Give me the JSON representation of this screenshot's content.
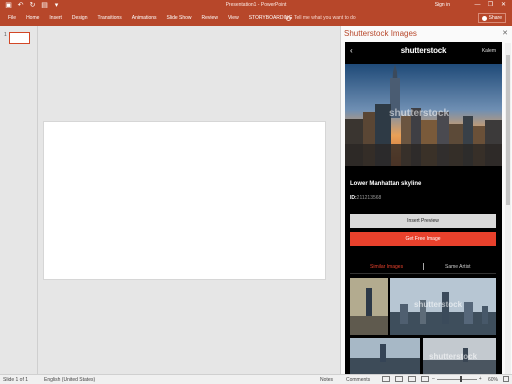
{
  "window": {
    "title": "Presentation1 - PowerPoint",
    "signin": "Sign in",
    "minimize_icon": "minimize-icon",
    "restore_icon": "restore-icon",
    "close_icon": "close-icon"
  },
  "qat": [
    "save-icon",
    "undo-icon",
    "redo-icon",
    "start-slideshow-icon",
    "qat-customize-icon"
  ],
  "ribbon": {
    "tabs": [
      "File",
      "Home",
      "Insert",
      "Design",
      "Transitions",
      "Animations",
      "Slide Show",
      "Review",
      "View",
      "STORYBOARDING"
    ],
    "tell_me": "Tell me what you want to do",
    "share": "Share"
  },
  "thumbnails": [
    {
      "number": "1"
    }
  ],
  "taskpane": {
    "title": "Shutterstock Images",
    "close": "✕",
    "header": {
      "back": "‹",
      "logo": "shutterstock",
      "user": "Kalem"
    },
    "image": {
      "title": "Lower Manhattan skyline",
      "id_label": "ID:",
      "id_value": "211213568",
      "watermark": "shutterstock"
    },
    "buttons": {
      "preview": "Insert Preview",
      "free": "Get Free Image"
    },
    "subtabs": {
      "similar": "Similar Images",
      "artist": "Same Artist"
    },
    "grid_watermark": "shutterstock"
  },
  "statusbar": {
    "slide": "Slide 1 of 1",
    "language": "English (United States)",
    "notes": "Notes",
    "comments": "Comments",
    "zoom": "60%",
    "zoom_level": 0.6
  },
  "colors": {
    "accent": "#b7472a",
    "button_red": "#e8412c"
  }
}
